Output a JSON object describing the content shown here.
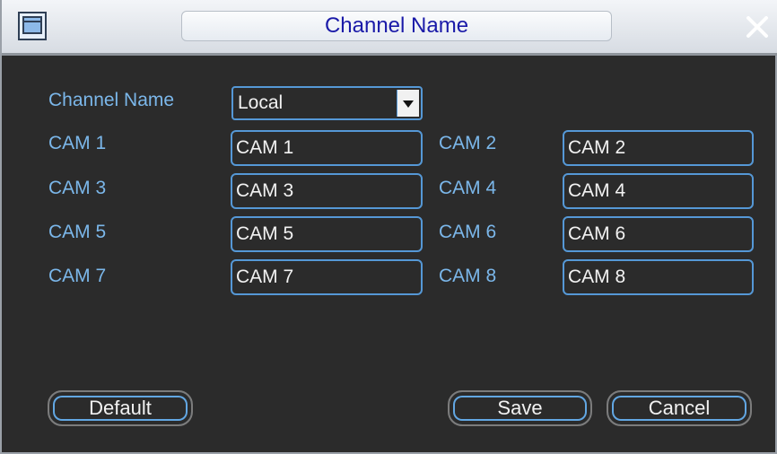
{
  "window": {
    "title": "Channel Name"
  },
  "form": {
    "channel_name_label": "Channel Name",
    "channel_name_value": "Local",
    "channels": [
      {
        "label": "CAM 1",
        "value": "CAM 1"
      },
      {
        "label": "CAM 2",
        "value": "CAM 2"
      },
      {
        "label": "CAM 3",
        "value": "CAM 3"
      },
      {
        "label": "CAM 4",
        "value": "CAM 4"
      },
      {
        "label": "CAM 5",
        "value": "CAM 5"
      },
      {
        "label": "CAM 6",
        "value": "CAM 6"
      },
      {
        "label": "CAM 7",
        "value": "CAM 7"
      },
      {
        "label": "CAM 8",
        "value": "CAM 8"
      }
    ]
  },
  "buttons": {
    "default": "Default",
    "save": "Save",
    "cancel": "Cancel"
  },
  "icons": {
    "app": "window-icon",
    "close": "close-icon",
    "dropdown": "chevron-down-icon"
  },
  "colors": {
    "accent": "#5598d6",
    "label": "#7bb7ea",
    "title_text": "#1a1aa8",
    "background": "#2b2b2b"
  }
}
